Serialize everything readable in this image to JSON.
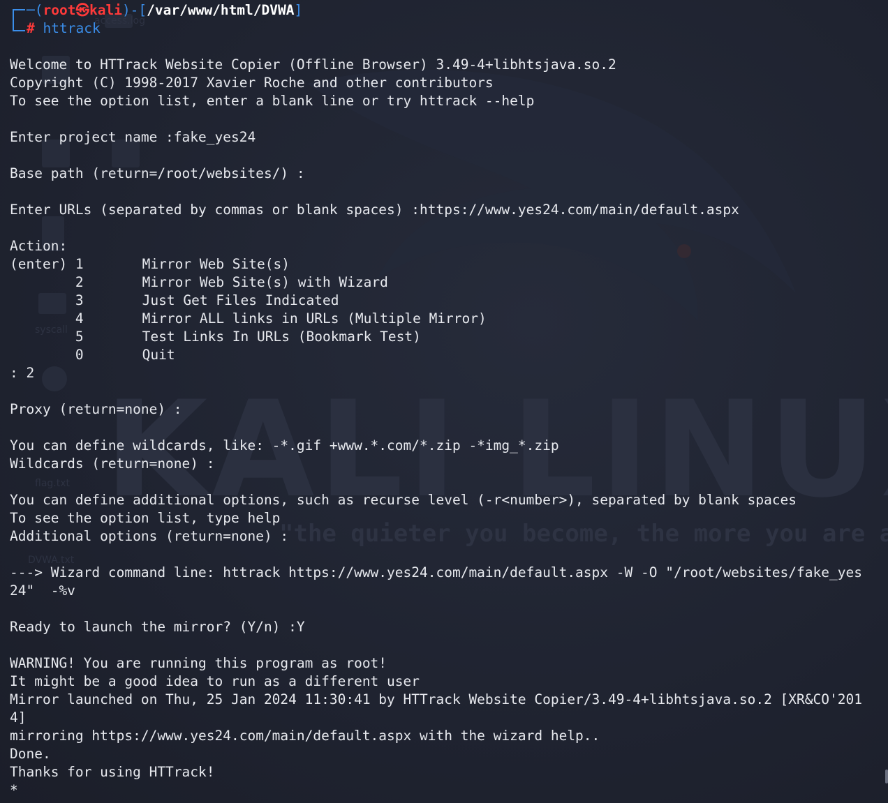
{
  "prompt": {
    "user": "root",
    "at_symbol": "㉿",
    "host": "kali",
    "path": "/var/www/html/DVWA",
    "hash": "#",
    "command": "httrack"
  },
  "wallpaper": {
    "title": "KALI LINUX",
    "tagline": "\"the quieter you become, the more you are able to hear\"",
    "desktop_icons": [
      "access.log",
      "syscall",
      "flag.txt",
      "DVWA.txt"
    ]
  },
  "output": {
    "welcome": "Welcome to HTTrack Website Copier (Offline Browser) 3.49-4+libhtsjava.so.2",
    "copyright": "Copyright (C) 1998-2017 Xavier Roche and other contributors",
    "option_hint": "To see the option list, enter a blank line or try httrack --help",
    "project_name": "Enter project name :fake_yes24",
    "base_path": "Base path (return=/root/websites/) :",
    "enter_urls": "Enter URLs (separated by commas or blank spaces) :https://www.yes24.com/main/default.aspx",
    "action_header": "Action:",
    "actions": [
      {
        "prefix": "(enter) 1",
        "label": "Mirror Web Site(s)"
      },
      {
        "prefix": "        2",
        "label": "Mirror Web Site(s) with Wizard"
      },
      {
        "prefix": "        3",
        "label": "Just Get Files Indicated"
      },
      {
        "prefix": "        4",
        "label": "Mirror ALL links in URLs (Multiple Mirror)"
      },
      {
        "prefix": "        5",
        "label": "Test Links In URLs (Bookmark Test)"
      },
      {
        "prefix": "        0",
        "label": "Quit"
      }
    ],
    "action_choice": ": 2",
    "proxy": "Proxy (return=none) :",
    "wildcards_hint": "You can define wildcards, like: -*.gif +www.*.com/*.zip -*img_*.zip",
    "wildcards": "Wildcards (return=none) :",
    "additional_hint": "You can define additional options, such as recurse level (-r<number>), separated by blank spaces",
    "additional_help": "To see the option list, type help",
    "additional": "Additional options (return=none) :",
    "wizard_line1": "---> Wizard command line: httrack https://www.yes24.com/main/default.aspx -W -O \"/root/websites/fake_yes",
    "wizard_line2": "24\"  -%v",
    "ready": "Ready to launch the mirror? (Y/n) :Y",
    "warning": "WARNING! You are running this program as root!",
    "idea": "It might be a good idea to run as a different user",
    "launched_line1": "Mirror launched on Thu, 25 Jan 2024 11:30:41 by HTTrack Website Copier/3.49-4+libhtsjava.so.2 [XR&CO'201",
    "launched_line2": "4]",
    "mirroring": "mirroring https://www.yes24.com/main/default.aspx with the wizard help..",
    "done": "Done.",
    "thanks": "Thanks for using HTTrack!",
    "cursor": "*"
  }
}
